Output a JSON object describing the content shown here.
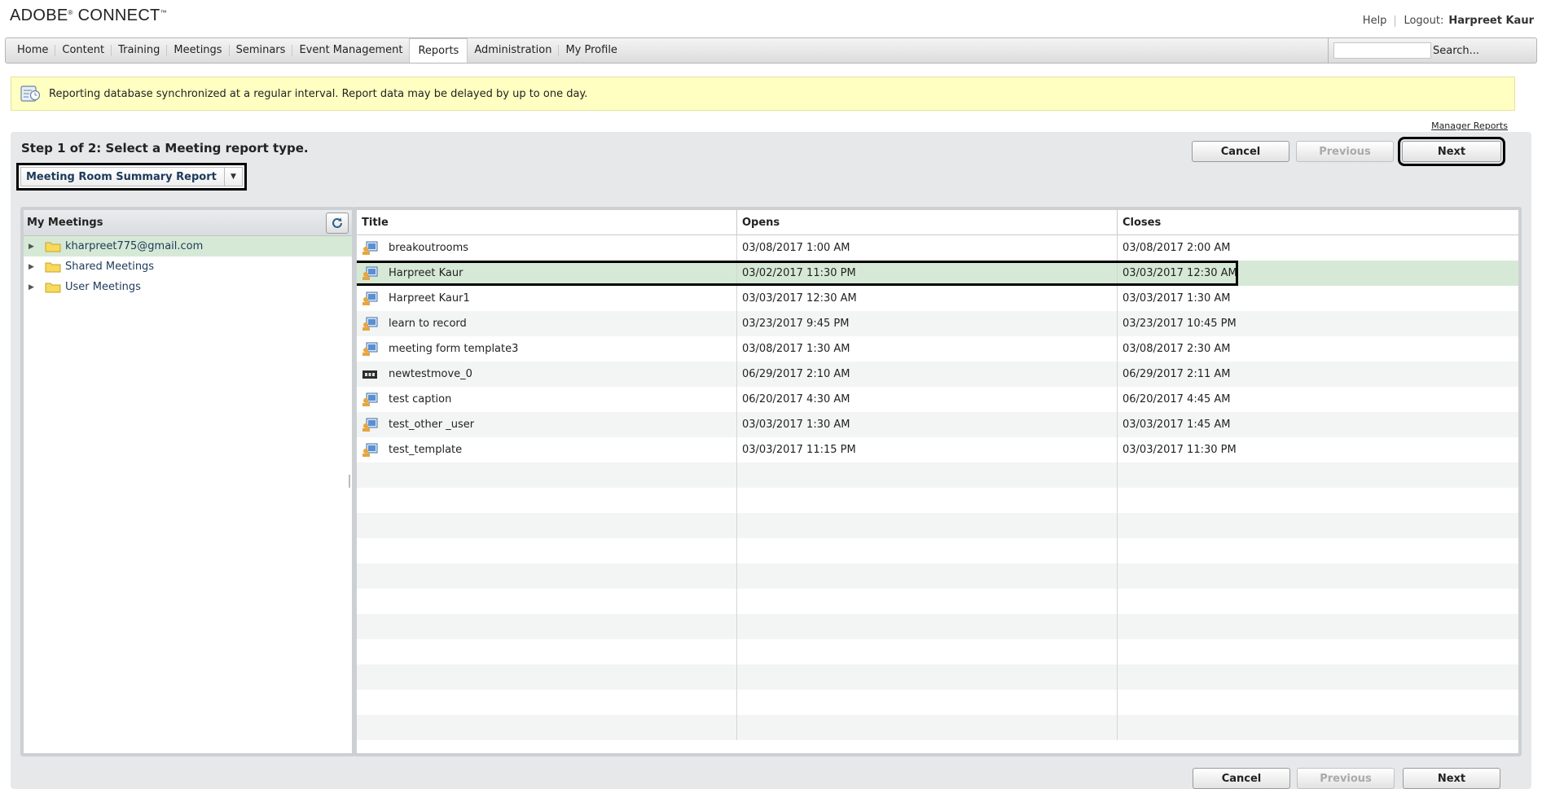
{
  "brand": {
    "name": "ADOBE",
    "reg": "®",
    "product": " CONNECT",
    "tm": "™"
  },
  "top_links": {
    "help": "Help",
    "logout": "Logout:",
    "user": "Harpreet Kaur"
  },
  "nav": {
    "items": [
      "Home",
      "Content",
      "Training",
      "Meetings",
      "Seminars",
      "Event Management",
      "Reports",
      "Administration",
      "My Profile"
    ],
    "active": "Reports",
    "search_label": "Search..."
  },
  "notice": {
    "text": "Reporting database synchronized at a regular interval. Report data may be delayed by up to one day."
  },
  "manager_reports": "Manager Reports",
  "step": {
    "title": "Step 1 of 2:  Select a Meeting report type."
  },
  "report_type": {
    "selected": "Meeting Room Summary Report"
  },
  "buttons": {
    "cancel": "Cancel",
    "previous": "Previous",
    "next": "Next"
  },
  "tree": {
    "header": "My Meetings",
    "items": [
      {
        "label": "kharpreet775@gmail.com",
        "selected": true
      },
      {
        "label": "Shared Meetings",
        "selected": false
      },
      {
        "label": "User Meetings",
        "selected": false
      }
    ]
  },
  "table": {
    "columns": [
      "Title",
      "Opens",
      "Closes"
    ],
    "rows": [
      {
        "icon": "meeting-icon",
        "title": "breakoutrooms",
        "opens": "03/08/2017 1:00 AM",
        "closes": "03/08/2017 2:00 AM"
      },
      {
        "icon": "meeting-icon",
        "title": "Harpreet Kaur",
        "opens": "03/02/2017 11:30 PM",
        "closes": "03/03/2017 12:30 AM",
        "selected": true
      },
      {
        "icon": "meeting-icon",
        "title": "Harpreet Kaur1",
        "opens": "03/03/2017 12:30 AM",
        "closes": "03/03/2017 1:30 AM"
      },
      {
        "icon": "meeting-icon",
        "title": "learn to record",
        "opens": "03/23/2017 9:45 PM",
        "closes": "03/23/2017 10:45 PM"
      },
      {
        "icon": "meeting-icon",
        "title": "meeting form template3",
        "opens": "03/08/2017 1:30 AM",
        "closes": "03/08/2017 2:30 AM"
      },
      {
        "icon": "video-icon",
        "title": "newtestmove_0",
        "opens": "06/29/2017 2:10 AM",
        "closes": "06/29/2017 2:11 AM"
      },
      {
        "icon": "meeting-icon",
        "title": "test caption",
        "opens": "06/20/2017 4:30 AM",
        "closes": "06/20/2017 4:45 AM"
      },
      {
        "icon": "meeting-icon",
        "title": "test_other _user",
        "opens": "03/03/2017 1:30 AM",
        "closes": "03/03/2017 1:45 AM"
      },
      {
        "icon": "meeting-icon",
        "title": "test_template",
        "opens": "03/03/2017 11:15 PM",
        "closes": "03/03/2017 11:30 PM"
      }
    ]
  }
}
